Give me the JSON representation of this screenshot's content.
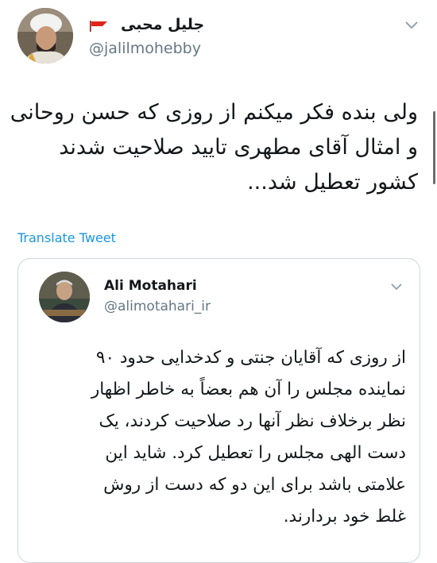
{
  "tweet": {
    "author": {
      "name": "جلیل محبی",
      "handle": "@jalilmohebby"
    },
    "body_lines": [
      "ولی بنده فکر میکنم از روزی که حسن روحانی",
      "و امثال آقای مطهری تایید صلاحیت شدند",
      "کشور تعطیل شد..."
    ],
    "translate_label": "Translate Tweet"
  },
  "quoted_tweet": {
    "author": {
      "name": "Ali Motahari",
      "handle": "@alimotahari_ir"
    },
    "body_lines": [
      "از روزی که آقایان جنتی و کدخدایی حدود ۹۰",
      "نماینده مجلس را آن هم بعضاً به خاطر اظهار",
      "نظر برخلاف نظر آنها رد صلاحیت کردند، یک",
      "دست الهی مجلس را تعطیل کرد. شاید این",
      "علامتی باشد برای این دو که دست از روش",
      "غلط خود بردارند."
    ]
  },
  "icons": {
    "flag": "flag-icon",
    "menu": "chevron-down-icon"
  },
  "colors": {
    "link": "#1b95e0",
    "handle": "#657786",
    "text": "#14171a",
    "border": "#ccd6dd",
    "flag": "#e0241b"
  }
}
